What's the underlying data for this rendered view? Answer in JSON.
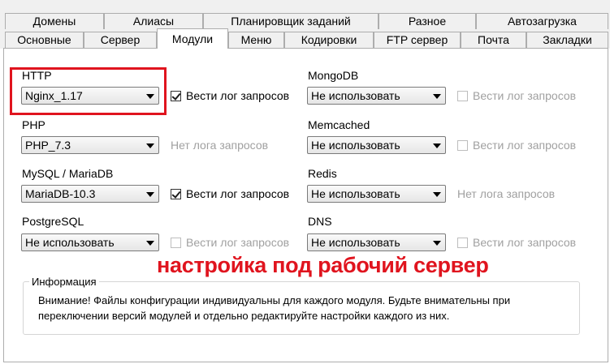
{
  "tabs_row1": [
    "Домены",
    "Алиасы",
    "Планировщик заданий",
    "Разное",
    "Автозагрузка"
  ],
  "tabs_row2": [
    "Основные",
    "Сервер",
    "Модули",
    "Меню",
    "Кодировки",
    "FTP сервер",
    "Почта",
    "Закладки"
  ],
  "active_tab": "Модули",
  "modules": {
    "http": {
      "label": "HTTP",
      "value": "Nginx_1.17",
      "log_label": "Вести лог запросов",
      "log_checked": true
    },
    "php": {
      "label": "PHP",
      "value": "PHP_7.3",
      "log_label": "Нет лога запросов"
    },
    "mysql": {
      "label": "MySQL / MariaDB",
      "value": "MariaDB-10.3",
      "log_label": "Вести лог запросов",
      "log_checked": true
    },
    "postgresql": {
      "label": "PostgreSQL",
      "value": "Не использовать",
      "log_label": "Вести лог запросов",
      "log_checked": false
    },
    "mongodb": {
      "label": "MongoDB",
      "value": "Не использовать",
      "log_label": "Вести лог запросов",
      "log_checked": false
    },
    "memcached": {
      "label": "Memcached",
      "value": "Не использовать",
      "log_label": "Вести лог запросов",
      "log_checked": false
    },
    "redis": {
      "label": "Redis",
      "value": "Не использовать",
      "log_label": "Нет лога запросов"
    },
    "dns": {
      "label": "DNS",
      "value": "Не использовать",
      "log_label": "Вести лог запросов",
      "log_checked": false
    }
  },
  "annotation": "настройка под рабочий сервер",
  "info": {
    "title": "Информация",
    "text": "Внимание! Файлы конфигурации индивидуальны для каждого модуля. Будьте внимательны при переключении версий модулей и отдельно редактируйте настройки каждого из них."
  },
  "colors": {
    "annotation": "#e0141e",
    "disabled_text": "#a0a0a0"
  }
}
